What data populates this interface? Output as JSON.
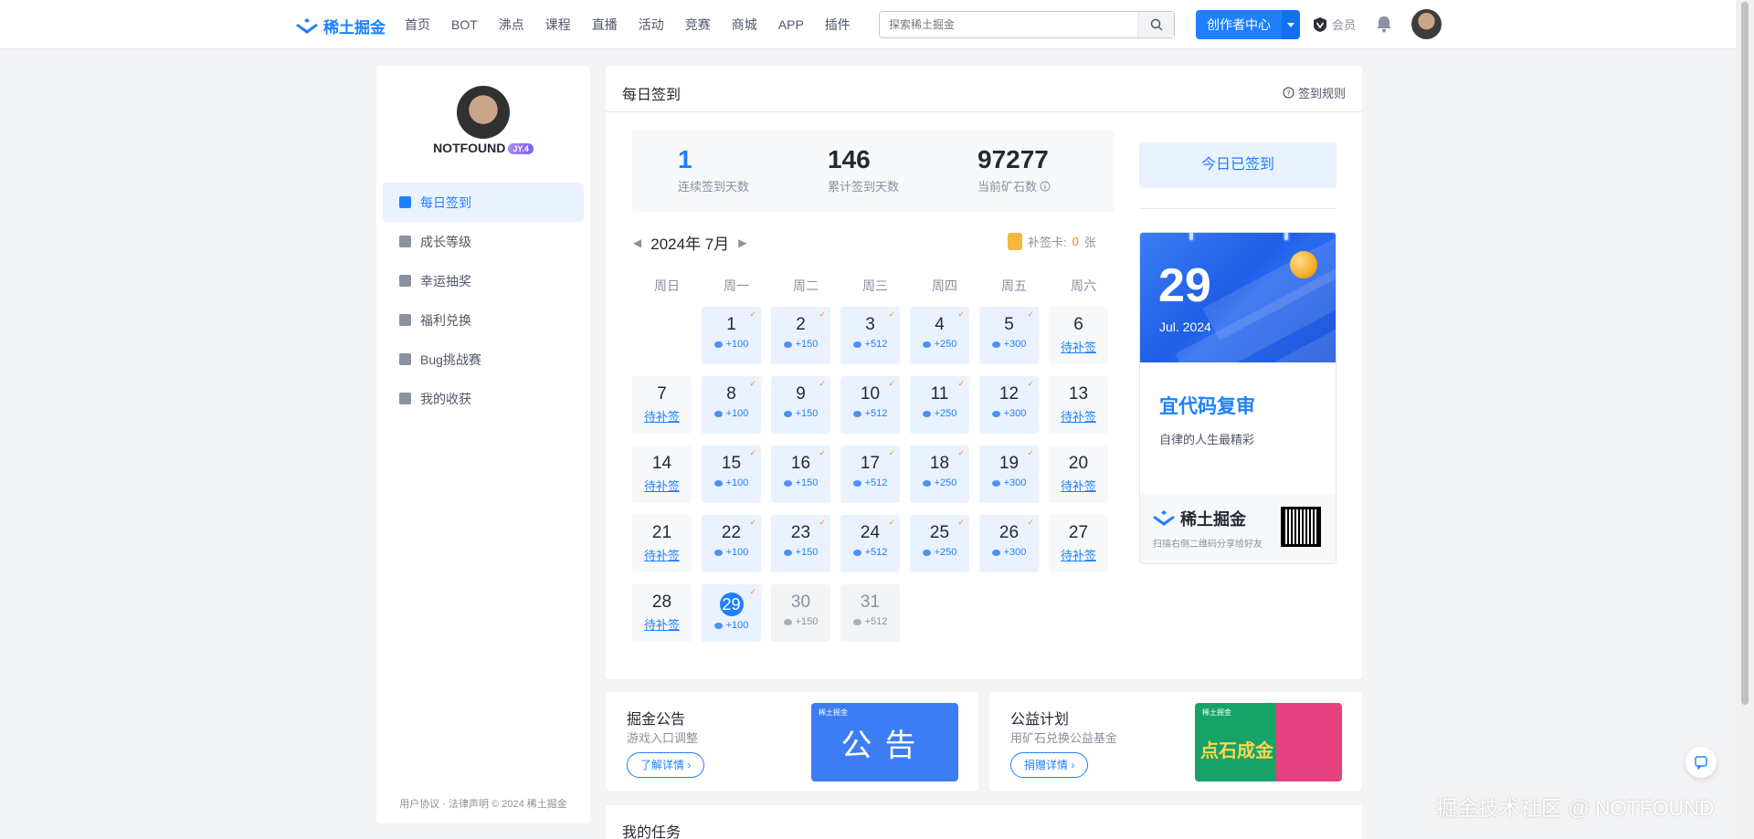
{
  "header": {
    "logo_text": "稀土掘金",
    "nav": [
      "首页",
      "BOT",
      "沸点",
      "课程",
      "直播",
      "活动",
      "竞赛",
      "商城",
      "APP",
      "插件"
    ],
    "search_placeholder": "探索稀土掘金",
    "creator_label": "创作者中心",
    "member_label": "会员"
  },
  "sidebar": {
    "username": "NOTFOUND",
    "level_badge": "JY.4",
    "items": [
      {
        "label": "每日签到",
        "icon": "calendar-check-icon",
        "active": true
      },
      {
        "label": "成长等级",
        "icon": "bar-chart-icon",
        "active": false
      },
      {
        "label": "幸运抽奖",
        "icon": "gift-icon",
        "active": false
      },
      {
        "label": "福利兑换",
        "icon": "coins-icon",
        "active": false
      },
      {
        "label": "Bug挑战赛",
        "icon": "bug-icon",
        "active": false
      },
      {
        "label": "我的收获",
        "icon": "bag-icon",
        "active": false
      }
    ],
    "copyright": "用户协议 · 法律声明 © 2024 稀土掘金"
  },
  "signin": {
    "title": "每日签到",
    "rules_label": "签到规则",
    "stats": [
      {
        "value": "1",
        "label": "连续签到天数"
      },
      {
        "value": "146",
        "label": "累计签到天数"
      },
      {
        "value": "97277",
        "label": "当前矿石数"
      }
    ],
    "month_label": "2024年 7月",
    "card_label": "补签卡:",
    "card_count": "0",
    "card_unit": "张",
    "weekdays": [
      "周日",
      "周一",
      "周二",
      "周三",
      "周四",
      "周五",
      "周六"
    ],
    "days": [
      {
        "day": "1",
        "status": "signed",
        "reward": "+100"
      },
      {
        "day": "2",
        "status": "signed",
        "reward": "+150"
      },
      {
        "day": "3",
        "status": "signed",
        "reward": "+512"
      },
      {
        "day": "4",
        "status": "signed",
        "reward": "+250"
      },
      {
        "day": "5",
        "status": "signed",
        "reward": "+300"
      },
      {
        "day": "6",
        "status": "missing",
        "reward": "待补签"
      },
      {
        "day": "7",
        "status": "missing",
        "reward": "待补签"
      },
      {
        "day": "8",
        "status": "signed",
        "reward": "+100"
      },
      {
        "day": "9",
        "status": "signed",
        "reward": "+150"
      },
      {
        "day": "10",
        "status": "signed",
        "reward": "+512"
      },
      {
        "day": "11",
        "status": "signed",
        "reward": "+250"
      },
      {
        "day": "12",
        "status": "signed",
        "reward": "+300"
      },
      {
        "day": "13",
        "status": "missing",
        "reward": "待补签"
      },
      {
        "day": "14",
        "status": "missing",
        "reward": "待补签"
      },
      {
        "day": "15",
        "status": "signed",
        "reward": "+100"
      },
      {
        "day": "16",
        "status": "signed",
        "reward": "+150"
      },
      {
        "day": "17",
        "status": "signed",
        "reward": "+512"
      },
      {
        "day": "18",
        "status": "signed",
        "reward": "+250"
      },
      {
        "day": "19",
        "status": "signed",
        "reward": "+300"
      },
      {
        "day": "20",
        "status": "missing",
        "reward": "待补签"
      },
      {
        "day": "21",
        "status": "missing",
        "reward": "待补签"
      },
      {
        "day": "22",
        "status": "signed",
        "reward": "+100"
      },
      {
        "day": "23",
        "status": "signed",
        "reward": "+150"
      },
      {
        "day": "24",
        "status": "signed",
        "reward": "+512"
      },
      {
        "day": "25",
        "status": "signed",
        "reward": "+250"
      },
      {
        "day": "26",
        "status": "signed",
        "reward": "+300"
      },
      {
        "day": "27",
        "status": "missing",
        "reward": "待补签"
      },
      {
        "day": "28",
        "status": "missing",
        "reward": "待补签"
      },
      {
        "day": "29",
        "status": "today",
        "reward": "+100"
      },
      {
        "day": "30",
        "status": "future",
        "reward": "+150"
      },
      {
        "day": "31",
        "status": "future",
        "reward": "+512"
      }
    ],
    "checked_label": "今日已签到",
    "calendar_card": {
      "day": "29",
      "month": "Jul. 2024",
      "quote": "宜代码复审",
      "sub": "自律的人生最精彩",
      "brand": "稀土掘金",
      "share_text": "扫描右侧二维码分享给好友"
    }
  },
  "cards": [
    {
      "title": "掘金公告",
      "sub": "游戏入口调整",
      "button": "了解详情",
      "image_text": "公告",
      "image_tag": "稀土掘金"
    },
    {
      "title": "公益计划",
      "sub": "用矿石兑换公益基金",
      "button": "捐赠详情",
      "image_text": "点石成金",
      "image_tag": "稀土掘金"
    }
  ],
  "tasks_title": "我的任务",
  "watermark": "掘金技术社区 @ NOTFOUND",
  "colors": {
    "accent": "#1e80ff",
    "check": "#ff8c1a"
  }
}
